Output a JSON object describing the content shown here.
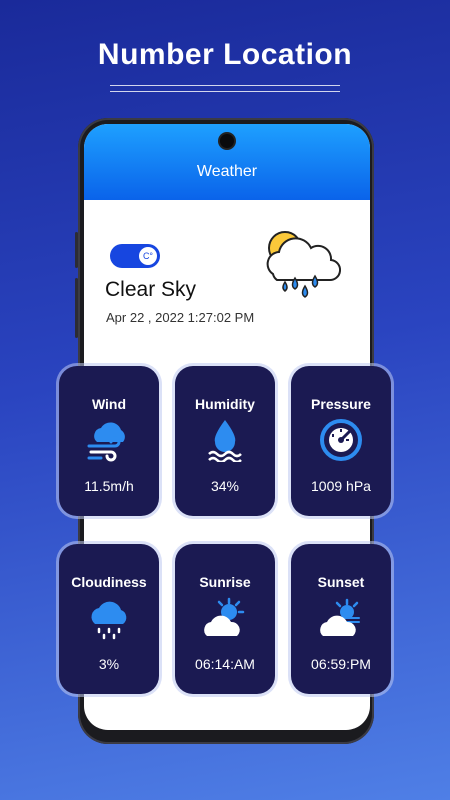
{
  "banner": {
    "title": "Number Location"
  },
  "app": {
    "title": "Weather"
  },
  "current": {
    "unit_toggle": "C°",
    "condition": "Clear Sky",
    "datetime": "Apr 22 , 2022 1:27:02 PM",
    "icon": "cloud-sun-rain-icon"
  },
  "cards": [
    {
      "title": "Wind",
      "value": "11.5m/h",
      "icon": "wind-cloud-icon"
    },
    {
      "title": "Humidity",
      "value": "34%",
      "icon": "humidity-drop-icon"
    },
    {
      "title": "Pressure",
      "value": "1009 hPa",
      "icon": "gauge-icon"
    },
    {
      "title": "Cloudiness",
      "value": "3%",
      "icon": "rain-cloud-icon"
    },
    {
      "title": "Sunrise",
      "value": "06:14:AM",
      "icon": "sunrise-icon"
    },
    {
      "title": "Sunset",
      "value": "06:59:PM",
      "icon": "sunset-icon"
    }
  ],
  "colors": {
    "accent": "#0a63ea",
    "card": "#1b1a52",
    "toggle": "#1746e0",
    "icon_blue": "#2d8cf0"
  }
}
